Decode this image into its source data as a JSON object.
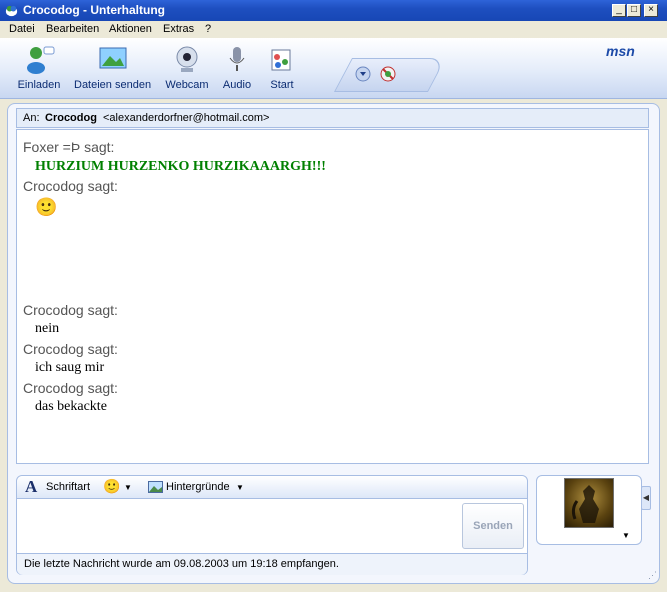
{
  "window": {
    "title": "Crocodog - Unterhaltung",
    "controls": {
      "minimize": "_",
      "maximize": "□",
      "close": "×"
    }
  },
  "menu": [
    "Datei",
    "Bearbeiten",
    "Aktionen",
    "Extras",
    "?"
  ],
  "toolbar": {
    "items": [
      {
        "label": "Einladen",
        "icon": "invite-icon"
      },
      {
        "label": "Dateien senden",
        "icon": "send-files-icon"
      },
      {
        "label": "Webcam",
        "icon": "webcam-icon"
      },
      {
        "label": "Audio",
        "icon": "microphone-icon"
      },
      {
        "label": "Start",
        "icon": "start-activities-icon"
      }
    ],
    "logo": "msn"
  },
  "to": {
    "label": "An:",
    "name": "Crocodog",
    "email": "<alexanderdorfner@hotmail.com>"
  },
  "conversation": [
    {
      "sender": "Foxer =Þ sagt:",
      "text": "HURZIUM HURZENKO HURZIKAAARGH!!!"
    },
    {
      "sender": "Crocodog sagt:",
      "text": "🙂"
    },
    {
      "sender": "Crocodog sagt:",
      "text": "nein"
    },
    {
      "sender": "Crocodog sagt:",
      "text": "ich saug mir"
    },
    {
      "sender": "Crocodog sagt:",
      "text": "das bekackte"
    }
  ],
  "format": {
    "font_label": "Schriftart",
    "emoticon": "🙂",
    "backgrounds_label": "Hintergründe"
  },
  "compose": {
    "value": "",
    "send_label": "Senden"
  },
  "status": "Die letzte Nachricht wurde am 09.08.2003 um 19:18 empfangen.",
  "colors": {
    "titlebar": "#2058d0",
    "accent": "#a7bde3",
    "highlight_text": "#008000"
  }
}
